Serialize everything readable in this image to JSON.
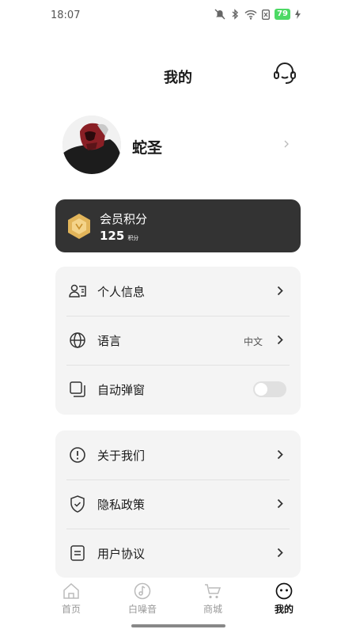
{
  "status_bar": {
    "time": "18:07",
    "battery": "79"
  },
  "header": {
    "title": "我的",
    "support_icon": "headset-icon"
  },
  "profile": {
    "username": "蛇圣"
  },
  "points": {
    "label": "会员积分",
    "value": "125",
    "unit": "积分"
  },
  "menu_group_1": [
    {
      "label": "个人信息",
      "icon": "person-card-icon"
    },
    {
      "label": "语言",
      "icon": "globe-icon",
      "value": "中文"
    },
    {
      "label": "自动弹窗",
      "icon": "popup-icon",
      "toggle_on": false
    }
  ],
  "menu_group_2": [
    {
      "label": "关于我们",
      "icon": "info-icon"
    },
    {
      "label": "隐私政策",
      "icon": "shield-icon"
    },
    {
      "label": "用户协议",
      "icon": "document-icon"
    }
  ],
  "tabs": [
    {
      "label": "首页",
      "icon": "home-icon"
    },
    {
      "label": "白噪音",
      "icon": "music-icon"
    },
    {
      "label": "商城",
      "icon": "cart-icon"
    },
    {
      "label": "我的",
      "icon": "face-icon",
      "active": true
    }
  ],
  "colors": {
    "card_dark": "#333333",
    "group_bg": "#f4f4f4",
    "accent_gold": "#e2b55a"
  }
}
